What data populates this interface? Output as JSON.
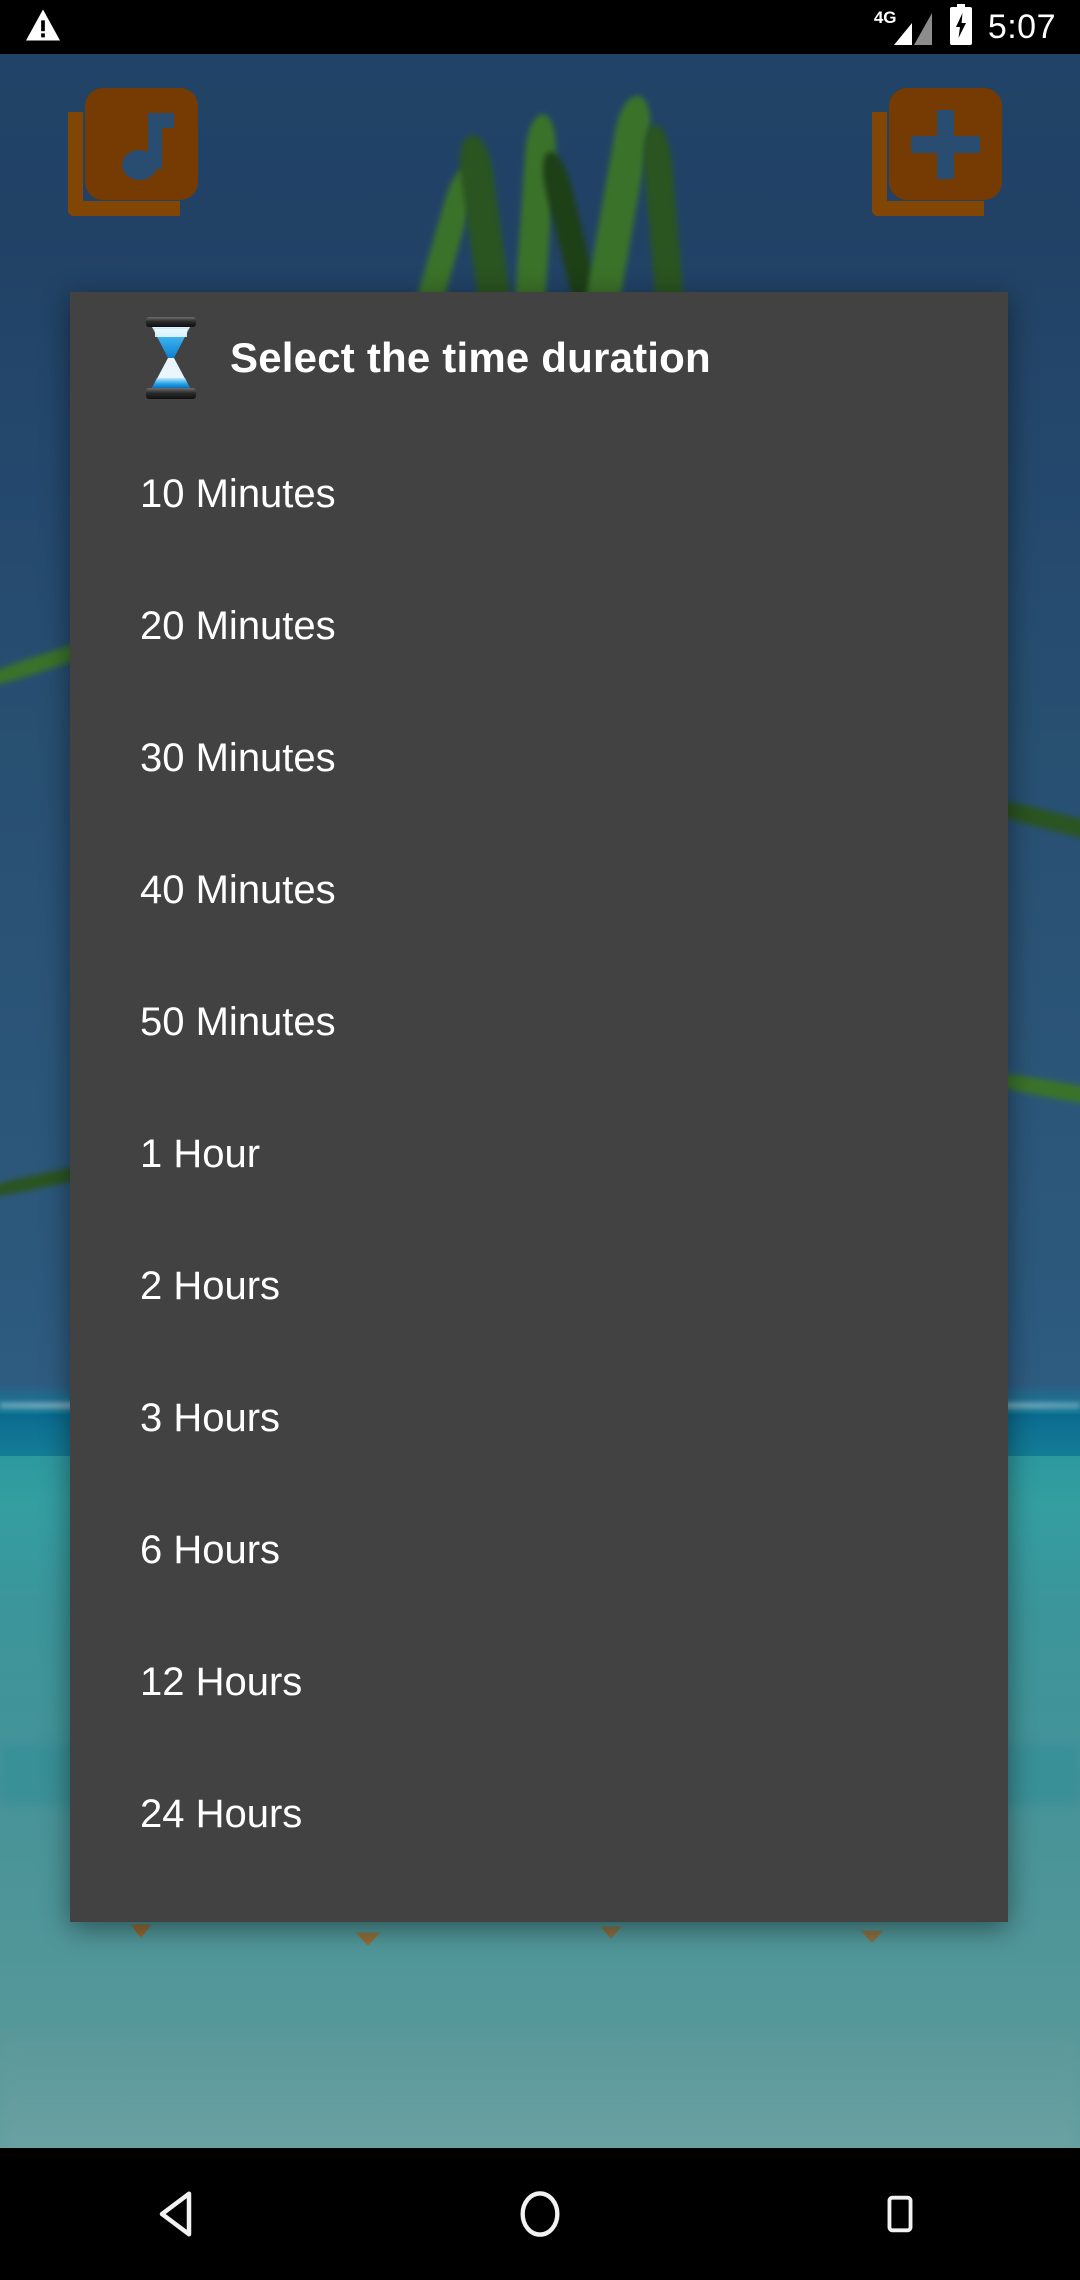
{
  "status_bar": {
    "warning_icon": "warning-triangle-icon",
    "network_label": "4G",
    "signal_icon": "signal-bars-icon",
    "battery_icon": "battery-charging-icon",
    "time": "5:07"
  },
  "app_background": {
    "library_icon_name": "music-library-icon",
    "add_icon_name": "add-to-library-icon"
  },
  "dialog": {
    "icon": "hourglass-icon",
    "title": "Select the time duration",
    "background_color": "#424242",
    "text_color": "#ffffff",
    "options": [
      {
        "label": "10 Minutes"
      },
      {
        "label": "20 Minutes"
      },
      {
        "label": "30 Minutes"
      },
      {
        "label": "40 Minutes"
      },
      {
        "label": "50 Minutes"
      },
      {
        "label": "1 Hour"
      },
      {
        "label": "2 Hours"
      },
      {
        "label": "3 Hours"
      },
      {
        "label": "6 Hours"
      },
      {
        "label": "12 Hours"
      },
      {
        "label": "24 Hours"
      }
    ]
  },
  "nav_bar": {
    "back": "back-triangle-icon",
    "home": "home-circle-icon",
    "recents": "recents-square-icon"
  }
}
